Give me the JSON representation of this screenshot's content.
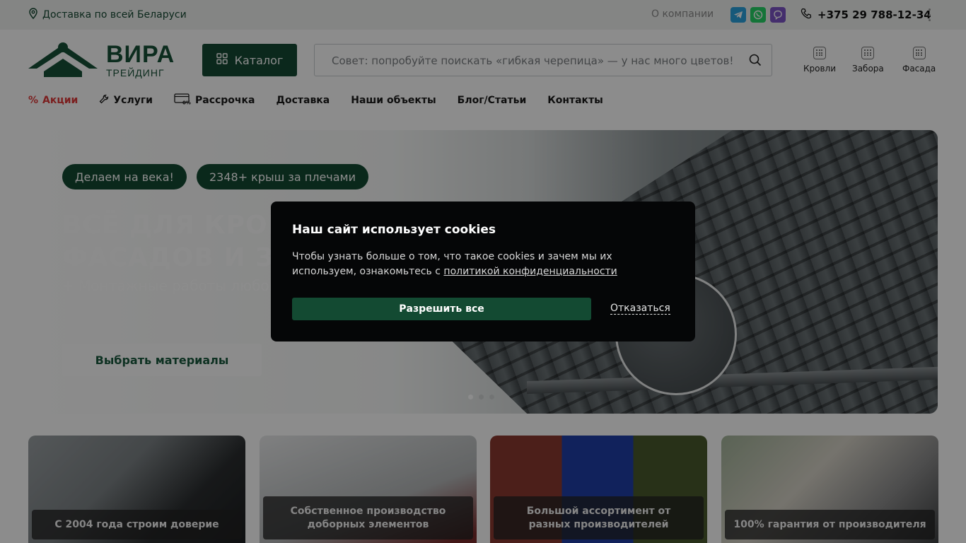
{
  "topbar": {
    "delivery": "Доставка по всей Беларуси",
    "about": "О компании",
    "phone": "+375 29 788-12-34"
  },
  "logo": {
    "line1": "ВИРА",
    "line2": "ТРЕЙДИНГ"
  },
  "header": {
    "catalog_label": "Каталог",
    "search_placeholder": "Совет: попробуйте поискать «гибкая черепица» — у нас много цветов!",
    "quick": [
      {
        "label": "Кровли"
      },
      {
        "label": "Забора"
      },
      {
        "label": "Фасада"
      }
    ]
  },
  "nav": [
    {
      "label": "Акции"
    },
    {
      "label": "Услуги"
    },
    {
      "label": "Рассрочка"
    },
    {
      "label": "Доставка"
    },
    {
      "label": "Наши объекты"
    },
    {
      "label": "Блог/Статьи"
    },
    {
      "label": "Контакты"
    }
  ],
  "hero": {
    "pill1": "Делаем на века!",
    "pill2": "2348+ крыш за плечами",
    "title_line1": "ВСЁ ДЛЯ КРОВ",
    "title_line2": "ФАСАДОВ И З",
    "subtitle": "+  Монтажные работы любой",
    "button": "Выбрать материалы",
    "slides_total": 3,
    "slide_active": 1
  },
  "features": [
    {
      "caption": "С 2004 года строим доверие"
    },
    {
      "caption": "Собственное производство доборных элементов"
    },
    {
      "caption": "Большой ассортимент от разных производителей"
    },
    {
      "caption": "100% гарантия от производителя"
    }
  ],
  "cookie": {
    "title": "Наш сайт использует cookies",
    "text": "Чтобы узнать больше о том, что такое cookies и зачем мы их используем, ознакомьтесь с",
    "link": "политикой конфиденциальности",
    "allow": "Разрешить все",
    "deny": "Отказаться"
  },
  "colors": {
    "brand": "#154a33",
    "promo": "#e03a3a"
  }
}
